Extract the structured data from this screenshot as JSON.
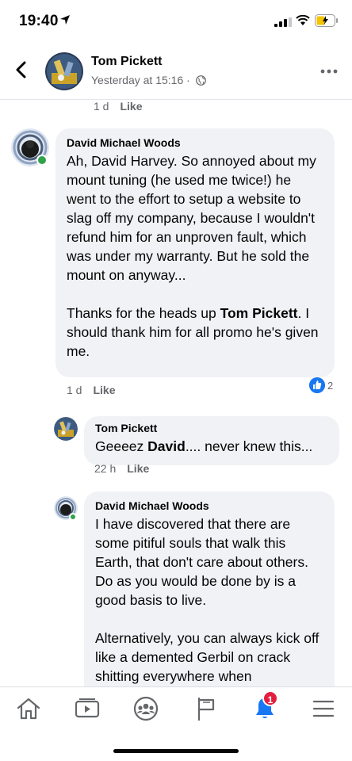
{
  "status": {
    "time": "19:40"
  },
  "header": {
    "name": "Tom Pickett",
    "subtitle": "Yesterday at 15:16 ·"
  },
  "top_meta": {
    "time": "1 d",
    "like": "Like"
  },
  "comments": [
    {
      "author": "David Michael Woods",
      "paragraphs": [
        "Ah, David Harvey. So annoyed about my mount tuning (he used me twice!) he went to the effort to setup a website to slag off my company, because I wouldn't refund him for an unproven fault, which was under my warranty. But he sold the mount on anyway...",
        "Thanks for the heads up {{Tom Pickett}}. I should thank him for all promo he's given me."
      ],
      "mention": "Tom Pickett",
      "text_a": "Ah, David Harvey. So annoyed about my mount tuning (he used me twice!) he went to the effort to setup a website to slag off my company, because I wouldn't refund him for an unproven fault, which was under my warranty. But he sold the mount on anyway...",
      "text_b_pre": "Thanks for the heads up ",
      "text_b_post": ". I should thank him for all promo he's given me.",
      "time": "1 d",
      "like": "Like",
      "reaction_count": "2"
    },
    {
      "author": "Tom Pickett",
      "mention": "David",
      "text_pre": "Geeeez ",
      "text_post": ".... never knew this...",
      "time": "22 h",
      "like": "Like"
    },
    {
      "author": "David Michael Woods",
      "text_a": "I have discovered that there are some pitiful souls that walk this Earth, that don't care about others. Do as you would be done by is a good basis to live.",
      "text_b": "Alternatively, you can always kick off like a demented Gerbil on crack shitting everywhere when"
    }
  ],
  "nav": {
    "items": [
      "home-icon",
      "watch-icon",
      "groups-icon",
      "pages-flag-icon",
      "notifications-icon",
      "menu-icon"
    ],
    "notification_badge": "1"
  },
  "colors": {
    "accent": "#1877f2",
    "bubble": "#f0f2f5",
    "online": "#31a24c",
    "badge": "#e41e3f"
  }
}
